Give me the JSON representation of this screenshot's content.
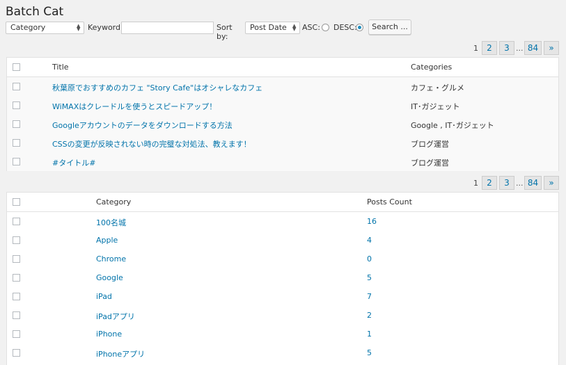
{
  "page": {
    "title": "Batch Cat"
  },
  "filters": {
    "category_select": "Category",
    "keyword_label": "Keyword:",
    "keyword_value": "",
    "sort_label": "Sort by:",
    "sort_select": "Post Date",
    "asc_label": "ASC:",
    "desc_label": "DESC:",
    "order_selected": "DESC",
    "search_button": "Search ..."
  },
  "pagination": {
    "current": "1",
    "pages": [
      "2",
      "3"
    ],
    "ellipsis": "...",
    "last": "84",
    "next": "»"
  },
  "posts_table": {
    "columns": [
      "Title",
      "Categories"
    ],
    "rows": [
      {
        "title": "秋葉原でおすすめのカフェ \"Story Cafe\"はオシャレなカフェ",
        "categories": "カフェ・グルメ"
      },
      {
        "title": "WiMAXはクレードルを使うとスピードアップ！",
        "categories": "IT･ガジェット"
      },
      {
        "title": "Googleアカウントのデータをダウンロードする方法",
        "categories": "Google , IT･ガジェット"
      },
      {
        "title": "CSSの変更が反映されない時の完璧な対処法、教えます！",
        "categories": "ブログ運営"
      },
      {
        "title": "#タイトル#",
        "categories": "ブログ運営"
      }
    ]
  },
  "categories_table": {
    "columns": [
      "Category",
      "Posts Count"
    ],
    "rows": [
      {
        "name": "100名城",
        "count": "16"
      },
      {
        "name": "Apple",
        "count": "4"
      },
      {
        "name": "Chrome",
        "count": "0"
      },
      {
        "name": "Google",
        "count": "5"
      },
      {
        "name": "iPad",
        "count": "7"
      },
      {
        "name": "iPadアプリ",
        "count": "2"
      },
      {
        "name": "iPhone",
        "count": "1"
      },
      {
        "name": "iPhoneアプリ",
        "count": "5"
      }
    ]
  }
}
